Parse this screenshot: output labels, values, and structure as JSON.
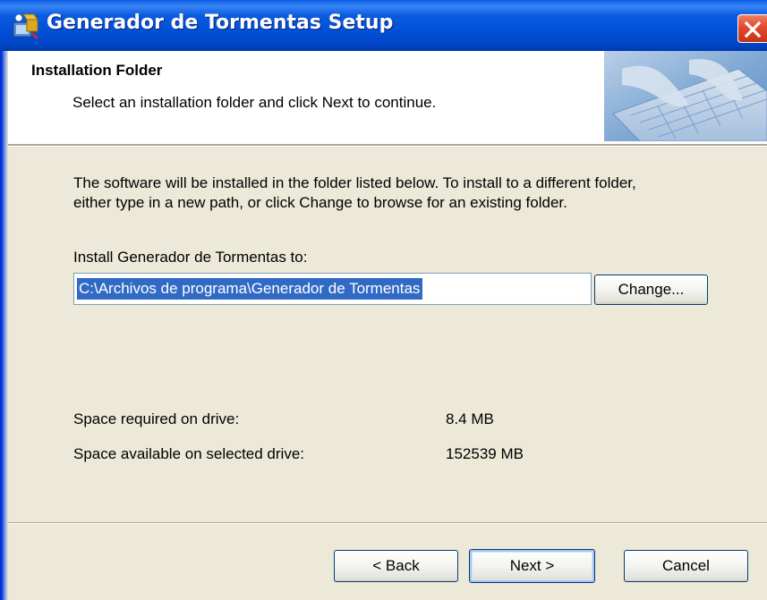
{
  "window": {
    "title": "Generador de Tormentas Setup",
    "icon": "installer-icon",
    "close_icon": "close-icon"
  },
  "header": {
    "title": "Installation Folder",
    "subtitle": "Select an installation folder and click Next to continue.",
    "image": "keyboard-hands-image"
  },
  "main": {
    "description_line1": "The software will be installed in the folder listed below. To install to a different folder,",
    "description_line2": "either type in a new path, or click Change to browse for an existing folder.",
    "install_label": "Install Generador de Tormentas to:",
    "install_path": "C:\\Archivos de programa\\Generador de Tormentas",
    "change_button": "Change...",
    "space_required_label": "Space required on drive:",
    "space_required_value": "8.4 MB",
    "space_available_label": "Space available on selected drive:",
    "space_available_value": "152539 MB"
  },
  "footer": {
    "back_button": "< Back",
    "next_button": "Next >",
    "cancel_button": "Cancel"
  },
  "colors": {
    "titlebar": "#0054e3",
    "dialog_bg": "#ece9d8",
    "selection": "#316ac5",
    "close_button": "#e2492e"
  }
}
